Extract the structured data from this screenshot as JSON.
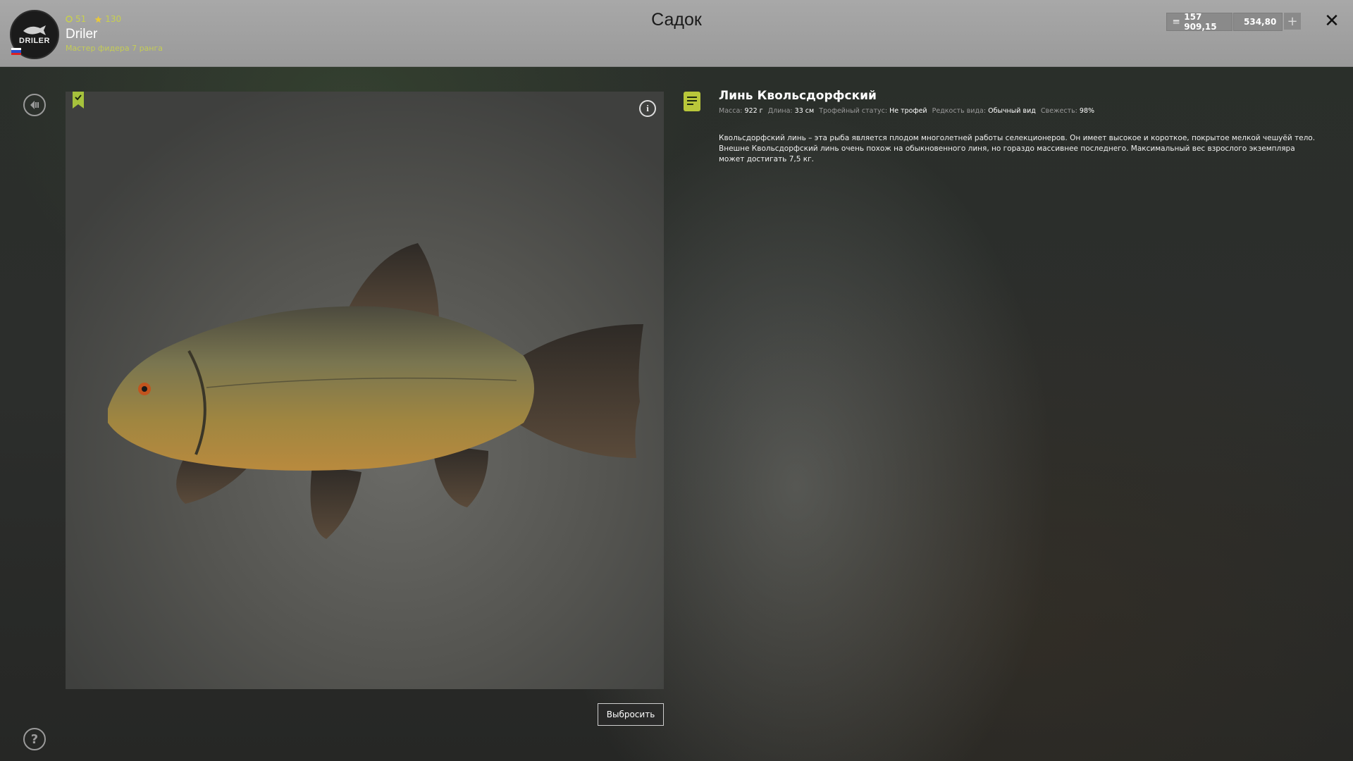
{
  "header": {
    "title": "Садок",
    "player": {
      "name": "Driler",
      "rank": "Мастер фидера 7 ранга",
      "level": "51",
      "stars": "130",
      "logo_text": "DRILER"
    },
    "currency": {
      "silver": "157 909,15",
      "gold": "534,80"
    },
    "plus_label": "+",
    "close_label": "✕"
  },
  "fish": {
    "name": "Линь Квольсдорфский",
    "stats": {
      "mass_label": "Масса:",
      "mass_value": "922 г",
      "length_label": "Длина:",
      "length_value": "33 см",
      "trophy_label": "Трофейный статус:",
      "trophy_value": "Не трофей",
      "rarity_label": "Редкость вида:",
      "rarity_value": "Обычный вид",
      "freshness_label": "Свежесть:",
      "freshness_value": "98%"
    },
    "description": "Квольсдорфский линь – эта рыба является плодом многолетней работы селекционеров. Он имеет высокое и короткое, покрытое мелкой чешуёй тело. Внешне Квольсдорфский линь очень похож на обыкновенного линя, но гораздо массивнее последнего. Максимальный вес взрослого экземпляра может достигать 7,5 кг."
  },
  "actions": {
    "discard_label": "Выбросить",
    "info_label": "i",
    "help_label": "?"
  },
  "colors": {
    "accent": "#b9c73a",
    "header_bg": "#a0a0a0"
  }
}
